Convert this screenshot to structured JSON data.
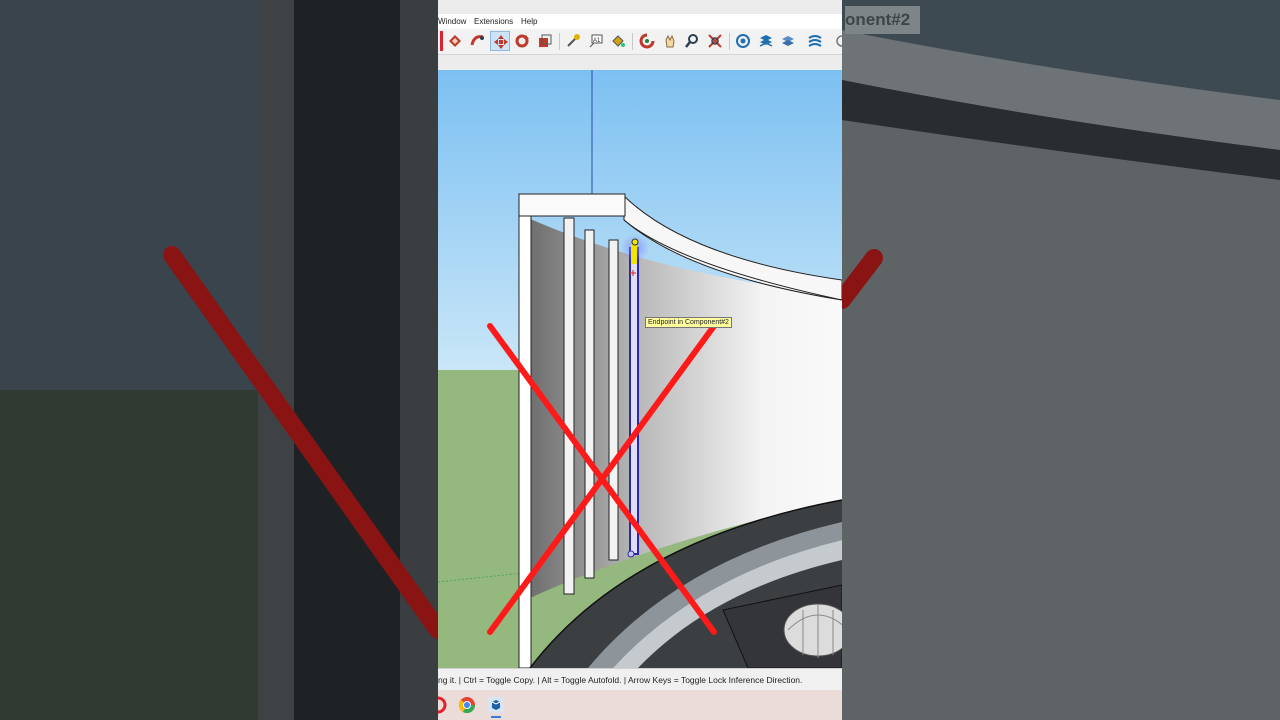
{
  "menu": {
    "window": "Window",
    "extensions": "Extensions",
    "help": "Help"
  },
  "toolbar": {
    "buttons": [
      "pushpull-icon",
      "followme-icon",
      "move-icon",
      "rotate-icon",
      "scale-icon",
      "tape-measure-icon",
      "text-icon",
      "paint-bucket-icon",
      "orbit-icon",
      "pan-icon",
      "zoom-icon",
      "zoom-extents-icon",
      "warehouse-icon",
      "extension-warehouse-icon",
      "layers-icon",
      "sandbox-icon",
      "more-icon"
    ],
    "active": "move-icon"
  },
  "viewport": {
    "tooltip": "Endpoint in Component#2"
  },
  "background_overlay": {
    "label": "onent#2"
  },
  "status": {
    "hint": "ng it. | Ctrl = Toggle Copy. | Alt = Toggle Autofold. | Arrow Keys = Toggle Lock Inference Direction."
  },
  "taskbar": {
    "apps": [
      "opera-icon",
      "chrome-icon",
      "sketchup-icon"
    ],
    "active": "sketchup-icon"
  },
  "colors": {
    "cross_mark": "#ff1a1a",
    "sky": "#8fc8f0",
    "ground": "#94b87e",
    "selection": "#2a2aa8",
    "tooltip_bg": "#ffff9e"
  }
}
